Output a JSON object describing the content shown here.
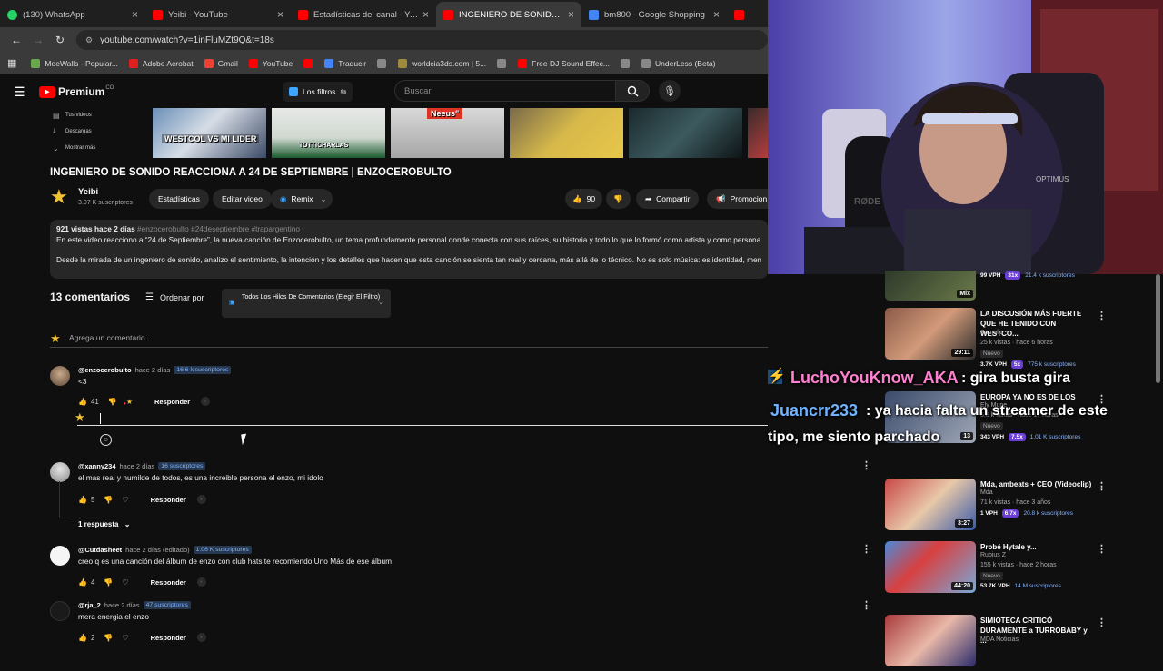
{
  "browser": {
    "tabs": [
      {
        "label": "(130) WhatsApp",
        "color": "#25d366"
      },
      {
        "label": "Yeibi - YouTube",
        "color": "#ff0000"
      },
      {
        "label": "Estadísticas del canal - YouTube",
        "color": "#ff0000"
      },
      {
        "label": "INGENIERO DE SONIDO REACCIONA",
        "color": "#ff0000"
      },
      {
        "label": "bm800 - Google Shopping",
        "color": "#4285f4"
      },
      {
        "label": "S",
        "color": "#ff0000"
      }
    ],
    "url": "youtube.com/watch?v=1inFluMZt9Q&t=18s",
    "bookmarks": [
      {
        "label": "MoeWalls - Popular...",
        "color": "#6aa84f"
      },
      {
        "label": "Adobe Acrobat",
        "color": "#e02020"
      },
      {
        "label": "Gmail",
        "color": "#ea4335"
      },
      {
        "label": "YouTube",
        "color": "#ff0000"
      },
      {
        "label": "",
        "color": "#ff0000"
      },
      {
        "label": "Traducir",
        "color": "#4285f4"
      },
      {
        "label": "",
        "color": "#888888"
      },
      {
        "label": "worldcia3ds.com | 5...",
        "color": "#9e8a3a"
      },
      {
        "label": "",
        "color": "#888888"
      },
      {
        "label": "Free DJ Sound Effec...",
        "color": "#ff0000"
      },
      {
        "label": "",
        "color": "#888888"
      },
      {
        "label": "UnderLess (Beta)",
        "color": "#888888"
      }
    ]
  },
  "header": {
    "brand": "Premium",
    "brand_suffix": "CO",
    "filters_label": "Los filtros",
    "search_placeholder": "Buscar"
  },
  "leftmini": [
    "Tus videos",
    "Descargas",
    "Mostrar más"
  ],
  "thumb_labels": [
    "WESTCOL VS MI LIDER",
    "TOTTICHARLAS",
    "Neeus\"",
    "",
    "",
    ""
  ],
  "video": {
    "title": "INGENIERO DE SONIDO REACCIONA A 24 DE SEPTIEMBRE | ENZOCEROBULTO",
    "channel_name": "Yeibi",
    "channel_subs": "3.07 K suscriptores",
    "btn_stats": "Estadísticas",
    "btn_edit": "Editar video",
    "btn_remix": "Remix",
    "likes": "90",
    "btn_share": "Compartir",
    "btn_promote": "Promocion"
  },
  "description": {
    "meta": "921 vistas  hace 2 días",
    "tags": "#enzocerobulto #24deseptiembre #trapargentino",
    "line1": "En este video reacciono a “24 de Septiembre”, la nueva canción de Enzocerobulto, un tema profundamente personal donde conecta con sus raíces, su historia y todo lo que lo formó como artista y como persona.",
    "line2": "Desde la mirada de un ingeniero de sonido, analizo el sentimiento, la intención y los detalles que hacen que esta canción se sienta tan real y cercana, más allá de lo técnico. No es solo música: es identidad, memoria"
  },
  "comments_header": {
    "count": "13 comentarios",
    "sort": "Ordenar por",
    "thread_filter": "Todos Los Hilos De Comentarios (Elegir El Filtro)",
    "add_placeholder": "Agrega un comentario..."
  },
  "comments": [
    {
      "user": "@enzocerobulto",
      "time": "hace 2 días",
      "subs": "16.6 k suscriptores",
      "text": "<3",
      "likes": "41",
      "reply": "Responder"
    },
    {
      "user": "@xanny234",
      "time": "hace 2 días",
      "subs": "16 suscriptores",
      "text": "el mas real y humilde de todos, es una increible persona el enzo, mi idolo",
      "likes": "5",
      "reply": "Responder"
    },
    {
      "user": "@Cutdasheet",
      "time": "hace 2 días (editado)",
      "subs": "1.06 K suscriptores",
      "text": "creo q es una canción del álbum de enzo con club hats te recomiendo Uno Más de ese álbum",
      "likes": "4",
      "reply": "Responder"
    },
    {
      "user": "@rja_2",
      "time": "hace 2 días",
      "subs": "47 suscriptores",
      "text": "mera energia el enzo",
      "likes": "2",
      "reply": "Responder"
    }
  ],
  "replies_link": "1 respuesta",
  "related": [
    {
      "title": "",
      "channel": "",
      "meta": "",
      "new": "",
      "vph": "99 VPH",
      "mult": "31x",
      "subs": "21.4 k suscriptores",
      "duration": "Mix"
    },
    {
      "title": "LA DISCUSIÓN MÁS FUERTE QUE HE TENIDO CON WESTCO...",
      "channel": "Samulx",
      "meta": "25 k vistas · hace 6 horas",
      "new": "Nuevo",
      "vph": "3.7K VPH",
      "mult": "5x",
      "subs": "775 k suscriptores",
      "duration": "29:11"
    },
    {
      "title": "EUROPA YA NO ES DE LOS",
      "channel": "Ely Mune",
      "meta": "5.8 k vistas · hace 17 horas",
      "new": "Nuevo",
      "vph": "343 VPH",
      "mult": "7.5x",
      "subs": "1.01 K suscriptores",
      "duration": "13"
    },
    {
      "title": "Mda, ambeats + CEO (Videoclip)",
      "channel": "Mda",
      "meta": "71 k vistas · hace 3 años",
      "new": "",
      "vph": "1 VPH",
      "mult": "6.7x",
      "subs": "20.8 k suscriptores",
      "duration": "3:27"
    },
    {
      "title": "Probé Hytale y...",
      "channel": "Rubius Z",
      "meta": "155 k vistas · hace 2 horas",
      "new": "Nuevo",
      "vph": "53.7K VPH",
      "mult": "",
      "subs": "14 M suscriptores",
      "duration": "44:20"
    },
    {
      "title": "SIMIOTECA CRITICÓ DURAMENTE a TURROBABY y ...",
      "channel": "MDA Noticias",
      "meta": "",
      "new": "",
      "vph": "",
      "mult": "",
      "subs": "",
      "duration": ""
    }
  ],
  "overlay": {
    "name1": "LuchoYouKnow_AKA",
    "msg1": " : gira busta gira",
    "name2": "Juancrr233",
    "msg2": " : ya hacia falta un streamer de este",
    "msg3": "tipo, me siento parchado"
  },
  "colors": {
    "accent": "#ff0000",
    "star": "#f1c232",
    "link": "#3ea6ff"
  }
}
